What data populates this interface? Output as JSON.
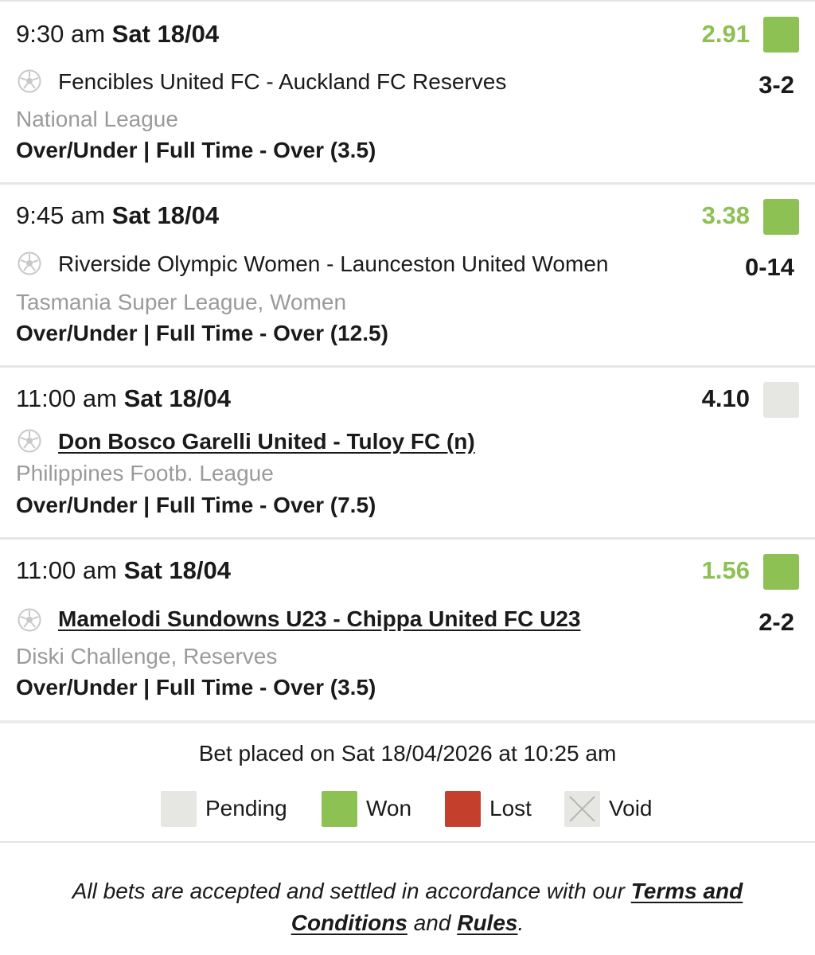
{
  "bets": [
    {
      "time": "9:30 am",
      "date": "Sat 18/04",
      "odds": "2.91",
      "status": "won",
      "match": "Fencibles United FC - Auckland FC Reserves",
      "match_linked": false,
      "score": "3-2",
      "league": "National League",
      "market": "Over/Under | Full Time - Over (3.5)"
    },
    {
      "time": "9:45 am",
      "date": "Sat 18/04",
      "odds": "3.38",
      "status": "won",
      "match": "Riverside Olympic Women - Launceston United Women",
      "match_linked": false,
      "score": "0-14",
      "league": "Tasmania Super League, Women",
      "market": "Over/Under | Full Time - Over (12.5)"
    },
    {
      "time": "11:00 am",
      "date": "Sat 18/04",
      "odds": "4.10",
      "status": "pending",
      "match": "Don Bosco Garelli United - Tuloy FC (n)",
      "match_linked": true,
      "score": "",
      "league": "Philippines Footb. League",
      "market": "Over/Under | Full Time - Over (7.5)"
    },
    {
      "time": "11:00 am",
      "date": "Sat 18/04",
      "odds": "1.56",
      "status": "won",
      "match": "Mamelodi Sundowns U23 - Chippa United FC U23",
      "match_linked": true,
      "score": "2-2",
      "league": "Diski Challenge, Reserves",
      "market": "Over/Under | Full Time - Over (3.5)"
    }
  ],
  "placed_text": "Bet placed on Sat 18/04/2026 at 10:25 am",
  "legend": {
    "pending": "Pending",
    "won": "Won",
    "lost": "Lost",
    "void": "Void"
  },
  "disclaimer": {
    "prefix": "All bets are accepted and settled in accordance with our",
    "terms_link": "Terms and Conditions",
    "middle": "and",
    "rules_link": "Rules",
    "suffix": "."
  },
  "colors": {
    "won": "#8dc153",
    "pending": "#e6e6e2",
    "lost": "#c4402c",
    "league_text": "#9a9a9a"
  },
  "icons": {
    "sport": "soccer-ball-icon",
    "void": "cross-icon"
  }
}
